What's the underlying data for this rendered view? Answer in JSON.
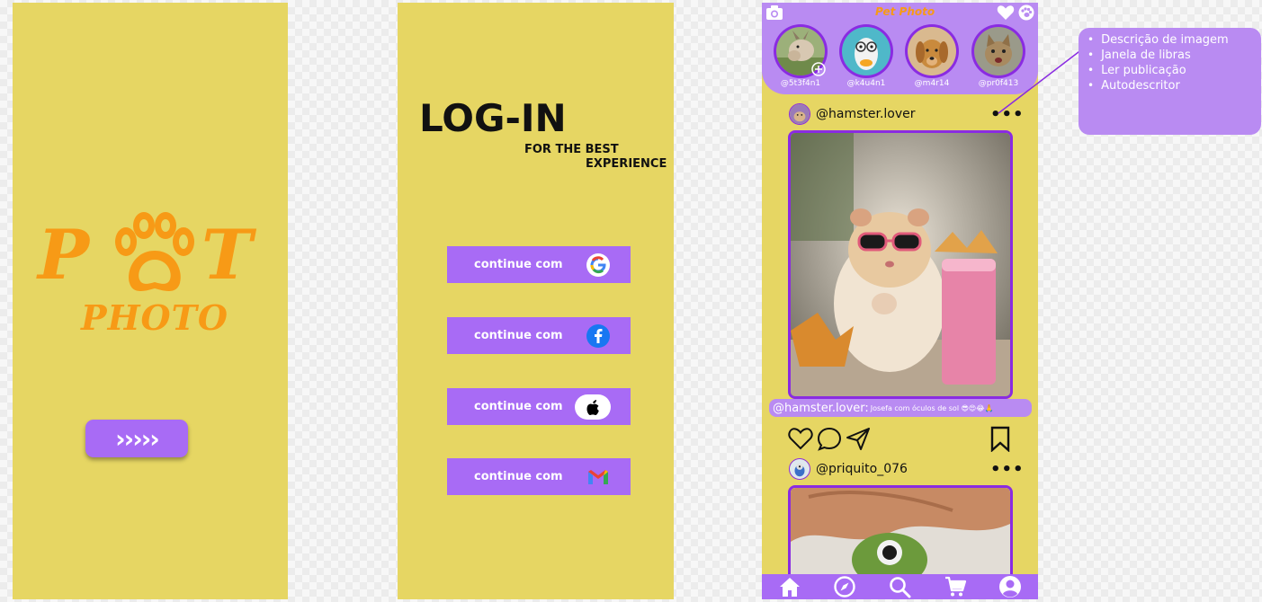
{
  "splash": {
    "logo_p": "P",
    "logo_t": "T",
    "logo_photo": "PHOTO",
    "next_button": "›››››"
  },
  "login": {
    "title": "LOG-IN",
    "subtitle_line1": "FOR THE BEST",
    "subtitle_line2": "EXPERIENCE",
    "buttons": [
      {
        "label": "continue com",
        "icon": "google-icon"
      },
      {
        "label": "continue com",
        "icon": "facebook-icon"
      },
      {
        "label": "continue com",
        "icon": "apple-icon"
      },
      {
        "label": "continue com",
        "icon": "gmail-icon"
      }
    ]
  },
  "feed": {
    "app_title": "Pet Photo",
    "stories": [
      {
        "name": "@5t3f4n1"
      },
      {
        "name": "@k4u4n1"
      },
      {
        "name": "@m4r14"
      },
      {
        "name": "@pr0f413"
      }
    ],
    "posts": [
      {
        "username": "@hamster.lover",
        "caption_user": "@hamster.lover:",
        "caption_text": "Josefa com óculos de sol 😎😍😂🙏"
      },
      {
        "username": "@priquito_076"
      }
    ],
    "more_icon": "•••"
  },
  "menu": {
    "items": [
      "Descrição de imagem",
      "Janela de libras",
      "Ler publicação",
      "Autodescritor"
    ]
  },
  "colors": {
    "screen_bg": "#e6d663",
    "purple": "#a86bf5",
    "purple_light": "#b98bf2",
    "purple_dark": "#8a2be2",
    "orange": "#f79a16"
  }
}
